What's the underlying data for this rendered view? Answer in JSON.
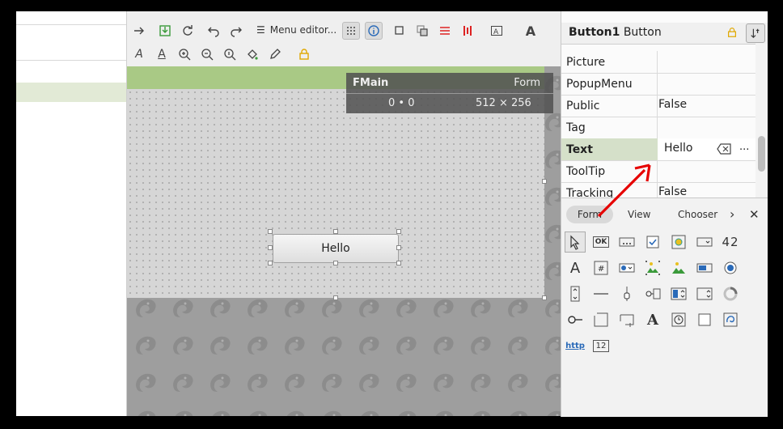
{
  "toolbar": {
    "menu_editor_label": "Menu editor..."
  },
  "form_tooltip": {
    "name": "FMain",
    "kind": "Form",
    "position": "0 • 0",
    "size": "512 × 256"
  },
  "button": {
    "label": "Hello"
  },
  "properties": {
    "title_name": "Button1",
    "title_type": "Button",
    "rows": [
      {
        "name": "Picture",
        "value": ""
      },
      {
        "name": "PopupMenu",
        "value": ""
      },
      {
        "name": "Public",
        "value": "False"
      },
      {
        "name": "Tag",
        "value": ""
      },
      {
        "name": "Text",
        "value": "Hello"
      },
      {
        "name": "ToolTip",
        "value": ""
      },
      {
        "name": "Tracking",
        "value": "False"
      }
    ],
    "ellipsis": "..."
  },
  "toolbox": {
    "tabs": [
      "Form",
      "View",
      "Chooser"
    ],
    "http_label": "http",
    "number_label": "12",
    "ok_label": "OK",
    "digits_label": "42"
  },
  "colors": {
    "form_header": "#a9c985",
    "selected_row": "#d5e0c9",
    "arrow": "#e60000"
  }
}
